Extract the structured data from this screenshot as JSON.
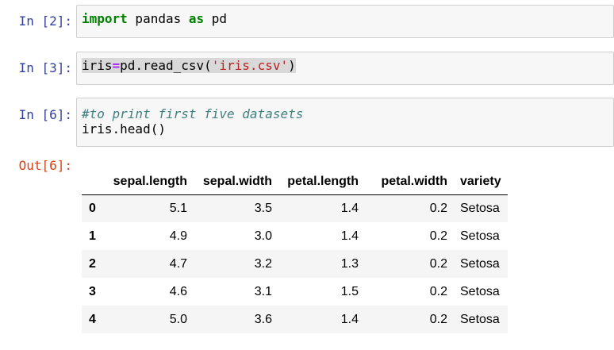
{
  "cells": [
    {
      "prompt": "In [2]:",
      "code": {
        "kw1": "import",
        "mid": " pandas ",
        "kw2": "as",
        "end": " pd"
      }
    },
    {
      "prompt": "In [3]:",
      "code": {
        "var": "iris",
        "op": "=",
        "call": "pd.read_csv(",
        "str": "'iris.csv'",
        "close": ")"
      }
    },
    {
      "prompt": "In [6]:",
      "code": {
        "comment": "#to print first five datasets",
        "line2": "iris.head()"
      }
    }
  ],
  "output": {
    "prompt": "Out[6]:",
    "columns": [
      "",
      "sepal.length",
      "sepal.width",
      "petal.length",
      "petal.width",
      "variety"
    ],
    "rows": [
      [
        "0",
        "5.1",
        "3.5",
        "1.4",
        "0.2",
        "Setosa"
      ],
      [
        "1",
        "4.9",
        "3.0",
        "1.4",
        "0.2",
        "Setosa"
      ],
      [
        "2",
        "4.7",
        "3.2",
        "1.3",
        "0.2",
        "Setosa"
      ],
      [
        "3",
        "4.6",
        "3.1",
        "1.5",
        "0.2",
        "Setosa"
      ],
      [
        "4",
        "5.0",
        "3.6",
        "1.4",
        "0.2",
        "Setosa"
      ]
    ]
  },
  "colors": {
    "input_prompt": "#303f9f",
    "output_prompt": "#d84315",
    "keyword": "#008000",
    "string": "#ba2121",
    "comment": "#408080",
    "operator": "#aa22ff",
    "cell_background": "#f7f7f7",
    "cell_border": "#cfcfcf"
  }
}
